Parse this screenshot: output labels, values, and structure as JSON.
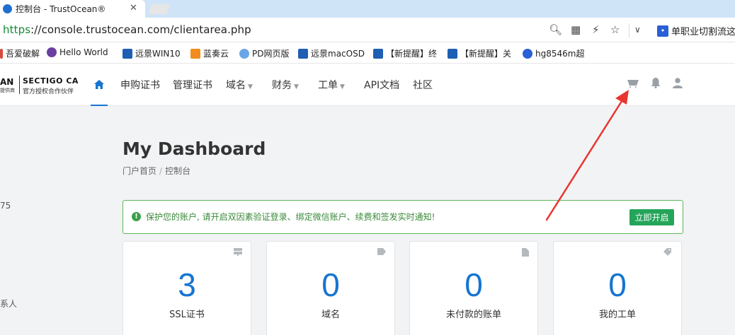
{
  "browser": {
    "tab_title": "控制台 - TrustOcean®",
    "tab_close": "✕",
    "url_proto": "https",
    "url_rest": "://console.trustocean.com/clientarea.php",
    "search_ext": "单职业切割流这"
  },
  "bookmarks": [
    {
      "label": "吾爱破解",
      "color": "#d84a3a"
    },
    {
      "label": "Hello World",
      "color": "#6b3fa0"
    },
    {
      "label": "远景WIN10",
      "color": "#1e5fb3"
    },
    {
      "label": "蓝奏云",
      "color": "#f28c1e"
    },
    {
      "label": "PD网页版",
      "color": "#6aa6e6"
    },
    {
      "label": "远景macOSD",
      "color": "#1e5fb3"
    },
    {
      "label": "【新提醒】终",
      "color": "#1e5fb3"
    },
    {
      "label": "【新提醒】关",
      "color": "#1e5fb3"
    },
    {
      "label": "hg8546m超",
      "color": "#2a5fd6"
    }
  ],
  "logo": {
    "brand": "AN",
    "brand_sub": "提供商",
    "ca": "SECTIGO CA",
    "ca_sub": "官方授权合作伙伴"
  },
  "nav": {
    "items": [
      {
        "label": "申购证书",
        "dropdown": false
      },
      {
        "label": "管理证书",
        "dropdown": false
      },
      {
        "label": "域名",
        "dropdown": true
      },
      {
        "label": "财务",
        "dropdown": true
      },
      {
        "label": "工单",
        "dropdown": true
      },
      {
        "label": "API文档",
        "dropdown": false
      },
      {
        "label": "社区",
        "dropdown": false
      }
    ]
  },
  "sidebar": {
    "frag1": "75",
    "frag2": "系人"
  },
  "page": {
    "title": "My Dashboard",
    "breadcrumb": [
      "门户首页",
      "控制台"
    ]
  },
  "alert": {
    "text": "保护您的账户, 请开启双因素验证登录、绑定微信账户、续费和签发实时通知!",
    "button": "立即开启"
  },
  "cards": [
    {
      "value": "3",
      "label": "SSL证书",
      "icon": "server-icon"
    },
    {
      "value": "0",
      "label": "域名",
      "icon": "tag-icon"
    },
    {
      "value": "0",
      "label": "未付款的账单",
      "icon": "file-icon"
    },
    {
      "value": "0",
      "label": "我的工单",
      "icon": "tags-icon"
    }
  ],
  "colors": {
    "accent": "#1675d1",
    "success": "#24a55a",
    "annotation_arrow": "#e8362f"
  }
}
